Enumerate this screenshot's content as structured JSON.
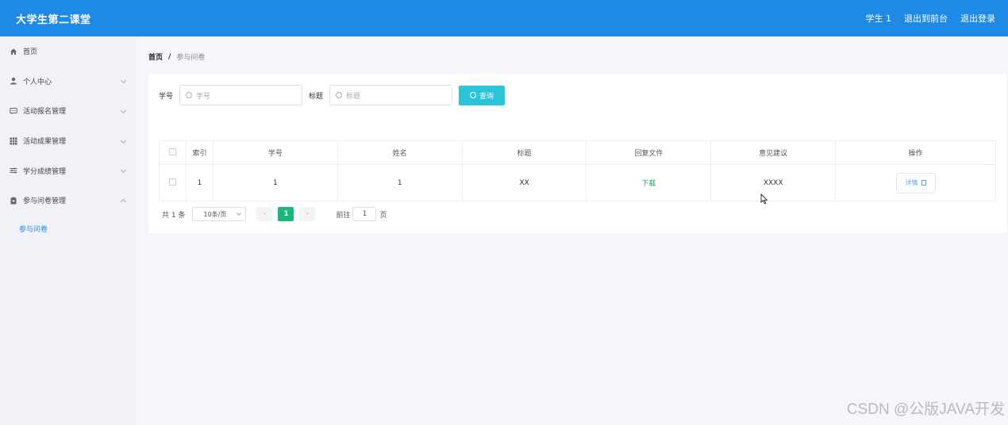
{
  "app": {
    "title": "大学生第二课堂",
    "header_actions": [
      "学生 1",
      "退出到前台",
      "退出登录"
    ]
  },
  "sidebar": {
    "items": [
      {
        "label": "首页",
        "icon": "home-icon",
        "expandable": false
      },
      {
        "label": "个人中心",
        "icon": "user-icon",
        "expandable": true
      },
      {
        "label": "活动报名管理",
        "icon": "message-icon",
        "expandable": true
      },
      {
        "label": "活动成果管理",
        "icon": "grid-icon",
        "expandable": true
      },
      {
        "label": "学分成绩管理",
        "icon": "sliders-icon",
        "expandable": true
      },
      {
        "label": "参与问卷管理",
        "icon": "clipboard-icon",
        "expandable": true,
        "expanded": true
      }
    ],
    "submenu": [
      "参与问卷"
    ]
  },
  "breadcrumb": {
    "home": "首页",
    "separator": "/",
    "current": "参与问卷"
  },
  "search": {
    "fields": [
      {
        "label": "学号",
        "placeholder": "学号"
      },
      {
        "label": "标题",
        "placeholder": "标题"
      }
    ],
    "button": "查询"
  },
  "table": {
    "columns": [
      "索引",
      "学号",
      "姓名",
      "标题",
      "回复文件",
      "意见建议",
      "操作"
    ],
    "rows": [
      {
        "index": "1",
        "student_id": "1",
        "name": "1",
        "title": "XX",
        "file": "下载",
        "suggestion": "XXXX",
        "action": "详情"
      }
    ]
  },
  "pagination": {
    "total": "共 1 条",
    "page_size": "10条/页",
    "current_page": "1",
    "goto_label": "前往",
    "goto_value": "1",
    "goto_suffix": "页"
  },
  "watermark": "CSDN @公版JAVA开发"
}
